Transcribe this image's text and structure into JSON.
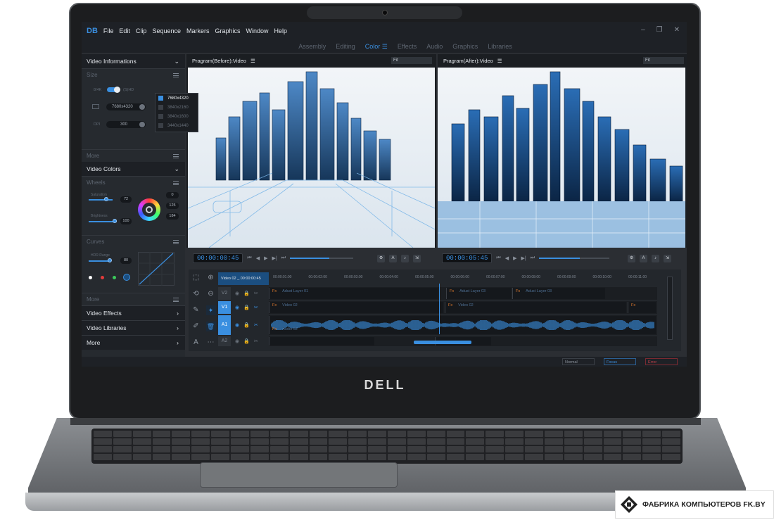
{
  "brand": "DELL",
  "watermark": {
    "text": "ФАБРИКА КОМПЬЮТЕРОВ FK.BY"
  },
  "app": {
    "logo": "DB",
    "menu": [
      "File",
      "Edit",
      "Clip",
      "Sequence",
      "Markers",
      "Graphics",
      "Window",
      "Help"
    ],
    "workspaces": [
      {
        "label": "Assembly",
        "active": false
      },
      {
        "label": "Editing",
        "active": false
      },
      {
        "label": "Color",
        "active": true
      },
      {
        "label": "Effects",
        "active": false
      },
      {
        "label": "Audio",
        "active": false
      },
      {
        "label": "Graphics",
        "active": false
      },
      {
        "label": "Libraries",
        "active": false
      }
    ],
    "accent": "#3a8fe0"
  },
  "left_panel": {
    "video_info": "Video Informations",
    "size": "Size",
    "toggle_left": "8/4K",
    "toggle_right": "(S)HD",
    "resolution_value": "7680x4320",
    "dpi_label": "DPI",
    "dpi_value": "300",
    "resolutions": [
      "7680x4320",
      "3840x2160",
      "3840x1600",
      "3440x1440"
    ],
    "selected_resolution": "7680x4320",
    "more1": "More",
    "video_colors": "Video Colors",
    "wheels": "Wheels",
    "saturation_label": "Saturation",
    "saturation_value": "72",
    "brightness_label": "Brightness",
    "brightness_value": "100",
    "rgb": [
      "0",
      "125",
      "184"
    ],
    "curves": "Curves",
    "hdr_label": "HDR Range",
    "hdr_value": "80",
    "more2": "More",
    "links": [
      "Video Effects",
      "Video Libraries",
      "More"
    ]
  },
  "monitors": {
    "before_title": "Pragram(Before):Video",
    "after_title": "Pragram(After):Video",
    "fit": "Fit",
    "before_tc": "00:00:00:45",
    "after_tc": "00:00:05:45",
    "before_progress": 0.62,
    "after_progress": 0.58
  },
  "timeline": {
    "sequence": "Video 02 _ 00:00:00:45",
    "ticks": [
      "00:00:01:00",
      "00:00:02:00",
      "00:00:03:00",
      "00:00:04:00",
      "00:00:05:00",
      "00:00:06:00",
      "00:00:07:00",
      "00:00:08:00",
      "00:00:09:00",
      "00:00:10:00",
      "00:00:11:00"
    ],
    "tracks": [
      {
        "id": "V2",
        "clips": [
          {
            "fx": "Fx",
            "name": "Adust Layer 01"
          },
          {
            "fx": "Fx",
            "name": "Adust Layer 03"
          },
          {
            "fx": "Fx",
            "name": "Adust Layer 03"
          }
        ]
      },
      {
        "id": "V1",
        "clips": [
          {
            "fx": "Fx",
            "name": "Video 02"
          },
          {
            "fx": "Fx",
            "name": "Video 02"
          },
          {
            "fx": "Fx",
            "name": ""
          }
        ]
      },
      {
        "id": "A1",
        "clips": [
          {
            "fx": "Fx",
            "name": "Audio 02"
          }
        ]
      },
      {
        "id": "A2",
        "clips": []
      }
    ]
  },
  "status": {
    "normal": "Normal",
    "focus": "Focus",
    "error": "Error"
  }
}
